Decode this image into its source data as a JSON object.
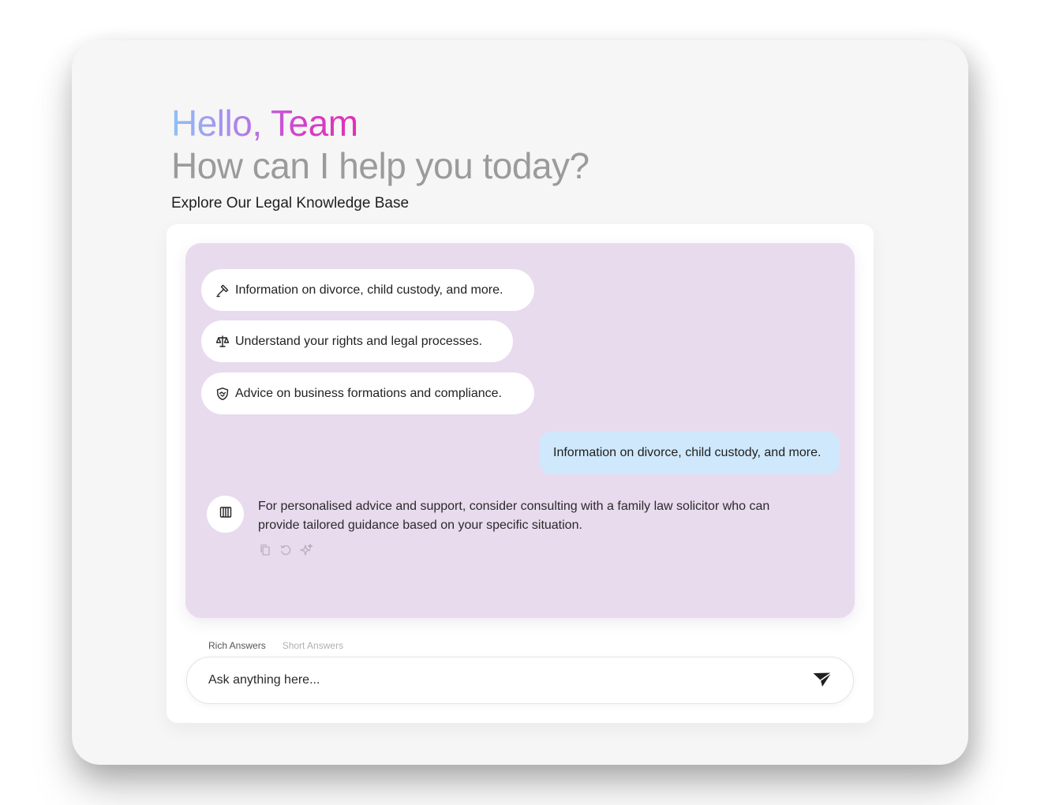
{
  "header": {
    "greeting": "Hello, Team",
    "subtitle": "How can I help you today?",
    "knowledge_base_heading": "Explore Our Legal Knowledge Base"
  },
  "suggestions": [
    {
      "icon": "gavel-icon",
      "label": "Information on divorce, child custody, and more."
    },
    {
      "icon": "scales-icon",
      "label": "Understand your rights and legal processes."
    },
    {
      "icon": "handshake-shield-icon",
      "label": "Advice on business formations and compliance."
    }
  ],
  "conversation": {
    "user_message": "Information on divorce, child custody, and more.",
    "bot_avatar_icon": "pillar-icon",
    "bot_message": "For personalised advice and support, consider consulting with a family law solicitor who can provide tailored guidance based on your specific situation.",
    "actions": [
      "copy-icon",
      "regenerate-icon",
      "sparkle-icon"
    ]
  },
  "answer_modes": {
    "selected": "Rich Answers",
    "options": [
      "Rich Answers",
      "Short Answers"
    ]
  },
  "input": {
    "placeholder": "Ask anything here...",
    "send_icon": "send-icon"
  },
  "colors": {
    "chat_background": "#e8dbee",
    "user_bubble": "#cfe8fb",
    "greeting_gradient_start": "#8ec2f5",
    "greeting_gradient_end": "#e22fb6",
    "subtitle": "#9b9b9b"
  }
}
